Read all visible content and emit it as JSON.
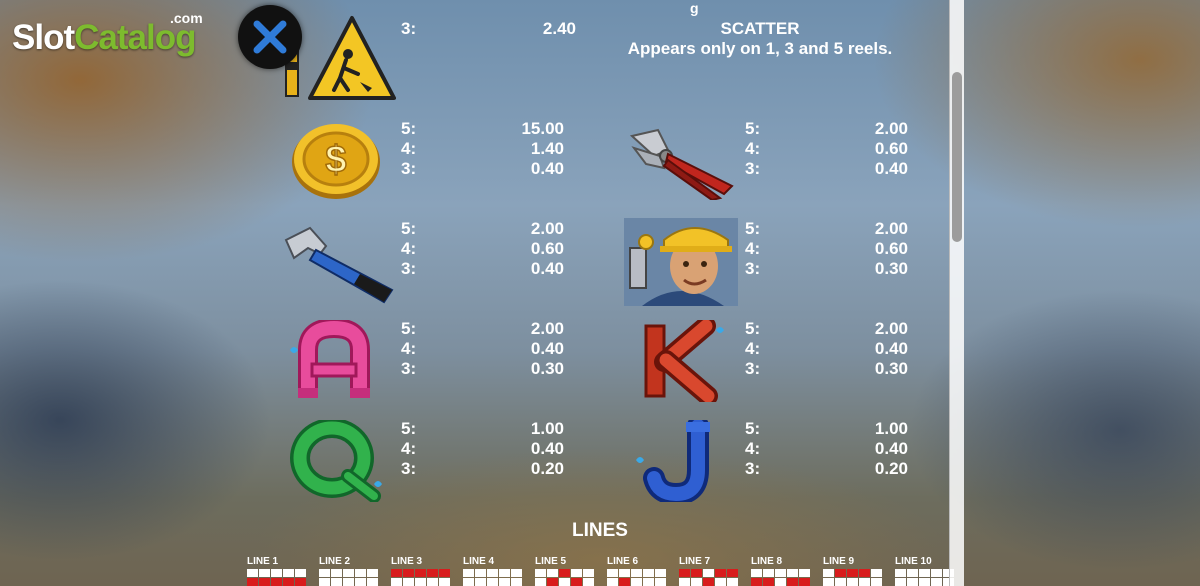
{
  "logo": {
    "word1": "Slot",
    "word2": "Catalog",
    "suffix": ".com"
  },
  "top_partial_text": "g",
  "scatter": {
    "count_label": "3:",
    "value": "2.40",
    "title": "SCATTER",
    "description": "Appears only on 1, 3 and 5 reels."
  },
  "paytable": [
    {
      "symbol": "coin-icon",
      "rows": [
        [
          "5:",
          "15.00"
        ],
        [
          "4:",
          "1.40"
        ],
        [
          "3:",
          "0.40"
        ]
      ]
    },
    {
      "symbol": "pliers-icon",
      "rows": [
        [
          "5:",
          "2.00"
        ],
        [
          "4:",
          "0.60"
        ],
        [
          "3:",
          "0.40"
        ]
      ]
    },
    {
      "symbol": "hammer-icon",
      "rows": [
        [
          "5:",
          "2.00"
        ],
        [
          "4:",
          "0.60"
        ],
        [
          "3:",
          "0.40"
        ]
      ]
    },
    {
      "symbol": "plumber-icon",
      "rows": [
        [
          "5:",
          "2.00"
        ],
        [
          "4:",
          "0.60"
        ],
        [
          "3:",
          "0.30"
        ]
      ]
    },
    {
      "symbol": "letter-a-icon",
      "rows": [
        [
          "5:",
          "2.00"
        ],
        [
          "4:",
          "0.40"
        ],
        [
          "3:",
          "0.30"
        ]
      ]
    },
    {
      "symbol": "letter-k-icon",
      "rows": [
        [
          "5:",
          "2.00"
        ],
        [
          "4:",
          "0.40"
        ],
        [
          "3:",
          "0.30"
        ]
      ]
    },
    {
      "symbol": "letter-q-icon",
      "rows": [
        [
          "5:",
          "1.00"
        ],
        [
          "4:",
          "0.40"
        ],
        [
          "3:",
          "0.20"
        ]
      ]
    },
    {
      "symbol": "letter-j-icon",
      "rows": [
        [
          "5:",
          "1.00"
        ],
        [
          "4:",
          "0.40"
        ],
        [
          "3:",
          "0.20"
        ]
      ]
    }
  ],
  "lines_title": "LINES",
  "lines": [
    {
      "label": "LINE 1"
    },
    {
      "label": "LINE 2"
    },
    {
      "label": "LINE 3"
    },
    {
      "label": "LINE 4"
    },
    {
      "label": "LINE 5"
    },
    {
      "label": "LINE 6"
    },
    {
      "label": "LINE 7"
    },
    {
      "label": "LINE 8"
    },
    {
      "label": "LINE 9"
    },
    {
      "label": "LINE 10"
    }
  ],
  "colors": {
    "accent_green": "#7dbb2e",
    "line_red": "#d81c1c"
  }
}
